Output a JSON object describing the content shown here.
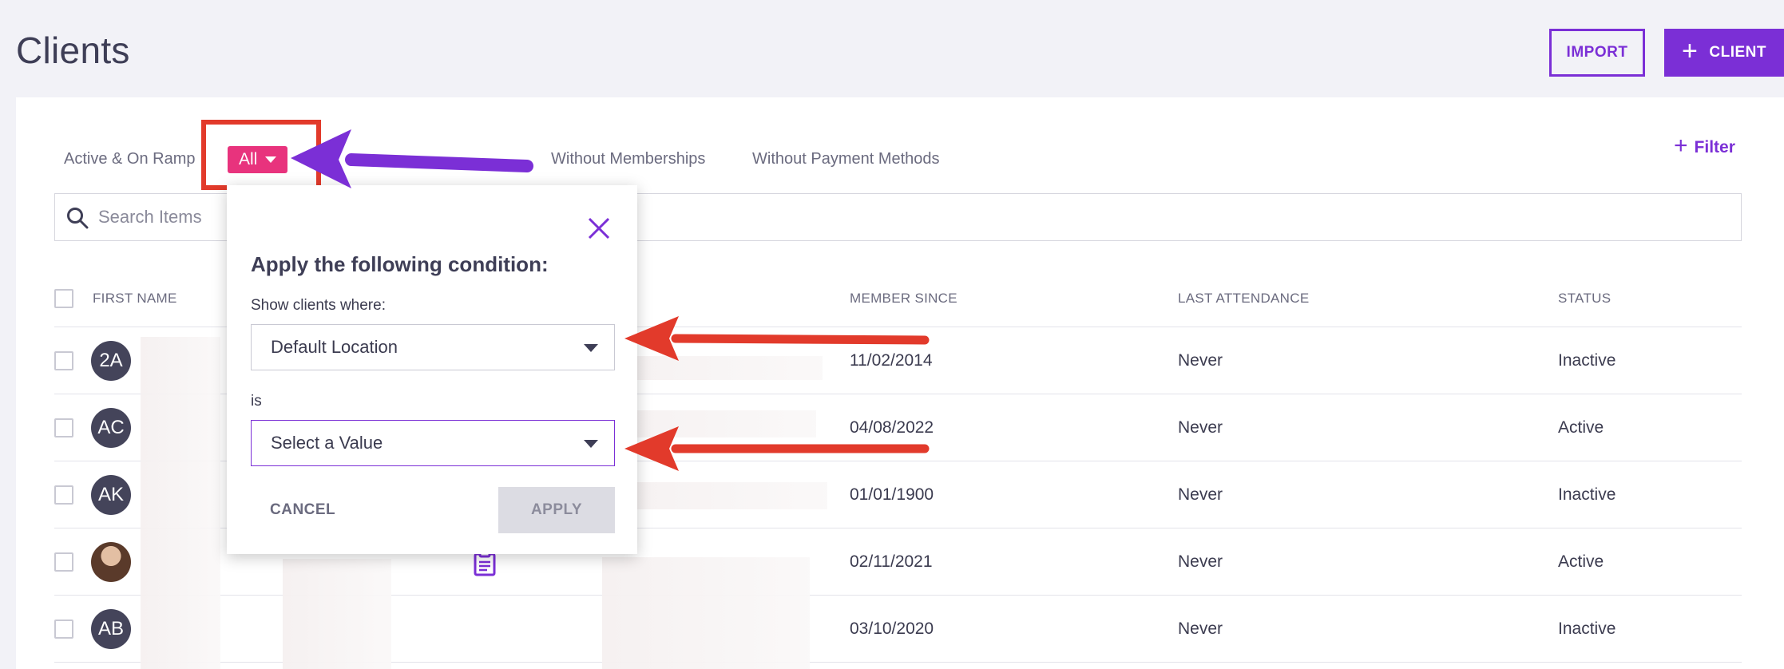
{
  "header": {
    "title": "Clients",
    "import_label": "IMPORT",
    "client_label": "CLIENT"
  },
  "tabs": [
    {
      "label": "Active & On Ramp"
    },
    {
      "label": "All"
    },
    {
      "label": "Without Memberships"
    },
    {
      "label": "Without Payment Methods"
    }
  ],
  "filter_label": "Filter",
  "search": {
    "placeholder": "Search Items"
  },
  "columns": {
    "first_name": "FIRST NAME",
    "member_since": "MEMBER SINCE",
    "last_attendance": "LAST ATTENDANCE",
    "status": "STATUS"
  },
  "rows": [
    {
      "initials": "2A",
      "member_since": "11/02/2014",
      "last_attendance": "Never",
      "status": "Inactive"
    },
    {
      "initials": "AC",
      "member_since": "04/08/2022",
      "last_attendance": "Never",
      "status": "Active"
    },
    {
      "initials": "AK",
      "member_since": "01/01/1900",
      "last_attendance": "Never",
      "status": "Inactive"
    },
    {
      "initials": "",
      "member_since": "02/11/2021",
      "last_attendance": "Never",
      "status": "Active"
    },
    {
      "initials": "AB",
      "member_since": "03/10/2020",
      "last_attendance": "Never",
      "status": "Inactive"
    }
  ],
  "modal": {
    "title": "Apply the following condition:",
    "show_label": "Show clients where:",
    "field_value": "Default Location",
    "is_label": "is",
    "value_placeholder": "Select a Value",
    "cancel_label": "CANCEL",
    "apply_label": "APPLY"
  },
  "colors": {
    "accent": "#7b2fd6",
    "chip": "#e8337d",
    "annotation_red": "#e23a2b"
  }
}
